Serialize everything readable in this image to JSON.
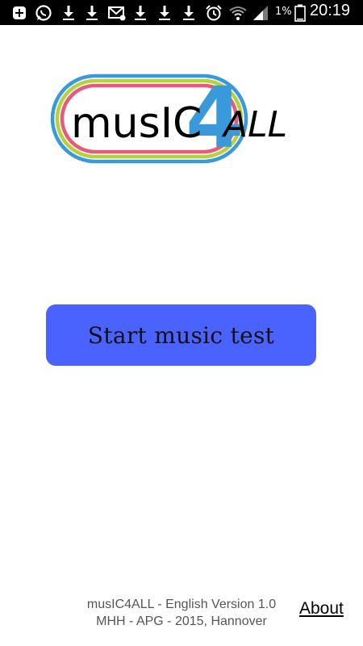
{
  "status_bar": {
    "icons": [
      "plus-box-icon",
      "whatsapp-icon",
      "download-icon",
      "download-icon",
      "email-icon",
      "download-icon",
      "download-icon",
      "download-icon",
      "alarm-icon",
      "wifi-icon",
      "signal-icon",
      "battery-icon"
    ],
    "battery": "1%",
    "time": "20:19"
  },
  "logo": {
    "text_main": "musIC",
    "text_number": "4",
    "text_tail": "ALL",
    "colors": {
      "outer_ring": "#3a9ad9",
      "middle_ring": "#b6d23a",
      "inner_ring": "#e85a7a",
      "accent": "#3a9ad9"
    }
  },
  "main": {
    "start_label": "Start music test",
    "button_color": "#4a63ff"
  },
  "footer": {
    "line1": "musIC4ALL - English Version 1.0",
    "line2": "MHH - APG - 2015, Hannover",
    "about_label": "About"
  }
}
